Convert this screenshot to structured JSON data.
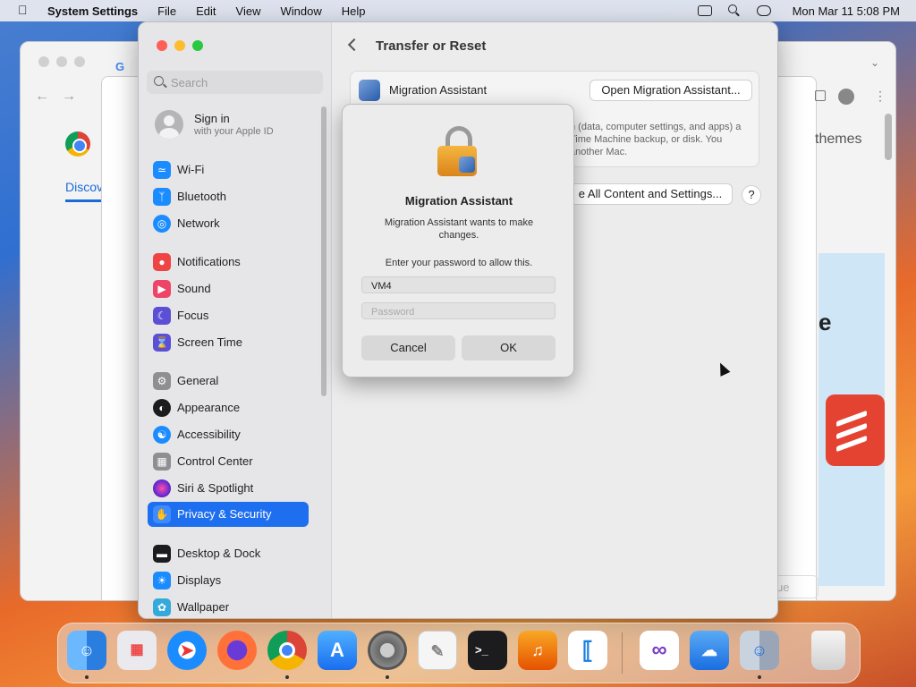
{
  "menubar": {
    "app_name": "System Settings",
    "menus": [
      "File",
      "Edit",
      "View",
      "Window",
      "Help"
    ],
    "datetime": "Mon Mar 11  5:08 PM"
  },
  "background_window": {
    "tab_text": "Discov",
    "side_text": "themes",
    "hero_letter": "e",
    "button_text": "ue"
  },
  "sidebar": {
    "search_placeholder": "Search",
    "signin_title": "Sign in",
    "signin_subtitle": "with your Apple ID",
    "items": [
      {
        "label": "Wi-Fi",
        "icon": "wifi-icon",
        "color": "#1a8cff"
      },
      {
        "label": "Bluetooth",
        "icon": "bluetooth-icon",
        "color": "#1a8cff"
      },
      {
        "label": "Network",
        "icon": "network-icon",
        "color": "#1a8cff"
      },
      {
        "label": "Notifications",
        "icon": "bell-icon",
        "color": "#ee4444"
      },
      {
        "label": "Sound",
        "icon": "speaker-icon",
        "color": "#ee4466"
      },
      {
        "label": "Focus",
        "icon": "moon-icon",
        "color": "#5b4fd6"
      },
      {
        "label": "Screen Time",
        "icon": "hourglass-icon",
        "color": "#5b4fd6"
      },
      {
        "label": "General",
        "icon": "gear-icon",
        "color": "#8e8e93"
      },
      {
        "label": "Appearance",
        "icon": "appearance-icon",
        "color": "#1c1c1e"
      },
      {
        "label": "Accessibility",
        "icon": "accessibility-icon",
        "color": "#1a8cff"
      },
      {
        "label": "Control Center",
        "icon": "control-center-icon",
        "color": "#8e8e93"
      },
      {
        "label": "Siri & Spotlight",
        "icon": "siri-icon",
        "color": "#7a3cc8"
      },
      {
        "label": "Privacy & Security",
        "icon": "hand-icon",
        "color": "#1a8cff"
      },
      {
        "label": "Desktop & Dock",
        "icon": "dock-icon",
        "color": "#1c1c1e"
      },
      {
        "label": "Displays",
        "icon": "display-icon",
        "color": "#1a8cff"
      },
      {
        "label": "Wallpaper",
        "icon": "wallpaper-icon",
        "color": "#34aadc"
      }
    ],
    "selected": "Privacy & Security"
  },
  "main": {
    "title": "Transfer or Reset",
    "migration_label": "Migration Assistant",
    "open_button": "Open Migration Assistant...",
    "description": "n (data, computer settings, and apps) a Time Machine backup, or disk. You another Mac.",
    "erase_button": "e All Content and Settings...",
    "help_label": "?"
  },
  "dialog": {
    "title": "Migration Assistant",
    "message": "Migration Assistant wants to make changes.",
    "prompt": "Enter your password to allow this.",
    "username_value": "VM4",
    "password_placeholder": "Password",
    "cancel_label": "Cancel",
    "ok_label": "OK"
  },
  "dock": {
    "apps": [
      {
        "name": "finder-icon",
        "color": "#3a8ee6"
      },
      {
        "name": "launchpad-icon",
        "color": "#e9e9ee"
      },
      {
        "name": "safari-icon",
        "color": "#1a8cff"
      },
      {
        "name": "firefox-icon",
        "color": "#ff7139"
      },
      {
        "name": "chrome-icon",
        "color": "#ffffff"
      },
      {
        "name": "app-store-icon",
        "color": "#1a8cff"
      },
      {
        "name": "system-settings-icon",
        "color": "#8e8e93"
      },
      {
        "name": "textedit-icon",
        "color": "#f5f5f5"
      },
      {
        "name": "terminal-icon",
        "color": "#1c1c1e"
      },
      {
        "name": "garageband-icon",
        "color": "#f57c00"
      },
      {
        "name": "vscode-icon",
        "color": "#ffffff"
      },
      {
        "name": "visual-studio-icon",
        "color": "#ffffff"
      },
      {
        "name": "weather-icon",
        "color": "#2f8be0"
      },
      {
        "name": "migration-assistant-icon",
        "color": "#9aa6b8"
      },
      {
        "name": "trash-icon",
        "color": "#e8e8e8"
      }
    ]
  }
}
